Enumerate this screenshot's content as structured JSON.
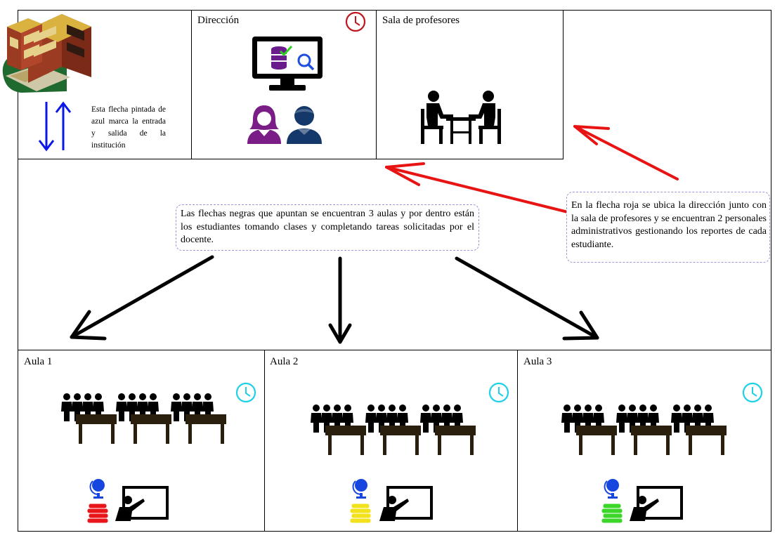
{
  "colors": {
    "red_arrow": "#e81414",
    "blue_arrow": "#0a17e6",
    "clock_red": "#c0151b",
    "clock_cyan": "#1fd0e8",
    "purple": "#7a1d86",
    "navy": "#15386b",
    "desk": "#2a1f0c",
    "books_red": "#e8161b",
    "books_yellow": "#f2e21b",
    "books_green": "#3cd62b",
    "globe": "#1745e0"
  },
  "entrance_note": "Esta flecha pintada de azul marca la entrada y salida de la institución",
  "direccion": {
    "title": "Dirección",
    "icons": [
      "computer-database-icon",
      "woman-icon",
      "man-icon",
      "clock-icon"
    ]
  },
  "sala": {
    "title": "Sala de profesores",
    "icons": [
      "meeting-table-icon"
    ]
  },
  "black_note": "Las flechas negras que apuntan se encuentran 3 aulas y por dentro están los estudiantes tomando clases y completando tareas solicitadas por el docente.",
  "red_note": "En la flecha roja se ubica la dirección junto con la sala de profesores y se encuentran 2 personales administrativos gestionando los reportes de cada estudiante.",
  "aulas": [
    {
      "title": "Aula 1",
      "books_color": "red"
    },
    {
      "title": "Aula 2",
      "books_color": "yellow"
    },
    {
      "title": "Aula 3",
      "books_color": "green"
    }
  ]
}
